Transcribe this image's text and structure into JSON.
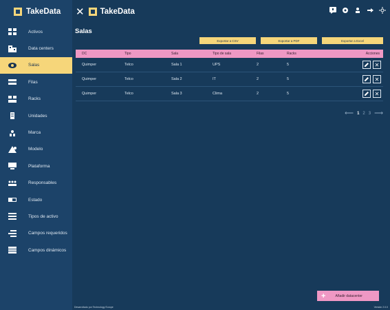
{
  "brand": {
    "name": "TakeData",
    "accent": "#f6d67a",
    "pink": "#ef98c4"
  },
  "sidebar": {
    "items": [
      {
        "label": "Activos",
        "icon": "grid-icon"
      },
      {
        "label": "Data centers",
        "icon": "building-icon"
      },
      {
        "label": "Salas",
        "icon": "room-icon",
        "active": true
      },
      {
        "label": "Filas",
        "icon": "rows-icon"
      },
      {
        "label": "Racks",
        "icon": "rack-icon"
      },
      {
        "label": "Unidades",
        "icon": "unit-icon"
      },
      {
        "label": "Marca",
        "icon": "brand-icon"
      },
      {
        "label": "Modelo",
        "icon": "model-icon"
      },
      {
        "label": "Plataforma",
        "icon": "platform-icon"
      },
      {
        "label": "Responsables",
        "icon": "people-icon"
      },
      {
        "label": "Estado",
        "icon": "status-icon"
      },
      {
        "label": "Tipos de activo",
        "icon": "list-icon"
      },
      {
        "label": "Campos requeridos",
        "icon": "required-fields-icon"
      },
      {
        "label": "Campos dinámicos",
        "icon": "dynamic-fields-icon"
      }
    ]
  },
  "header": {
    "title": "TakeData"
  },
  "main": {
    "title": "Salas",
    "exports": {
      "csv": "Exportar a CSV",
      "pdf": "Exportar a PDF",
      "excel": "Exportar a Excel"
    },
    "table": {
      "headers": {
        "dc": "DC",
        "tipo": "Tipo",
        "sala": "Sala",
        "tipo_sala": "Tipo de sala",
        "filas": "Filas",
        "racks": "Racks",
        "acciones": "Acciones"
      },
      "rows": [
        {
          "dc": "Quimper",
          "tipo": "Telco",
          "sala": "Sala 1",
          "tipo_sala": "UPS",
          "filas": "2",
          "racks": "5"
        },
        {
          "dc": "Quimper",
          "tipo": "Telco",
          "sala": "Sala 2",
          "tipo_sala": "IT",
          "filas": "2",
          "racks": "5"
        },
        {
          "dc": "Quimper",
          "tipo": "Telco",
          "sala": "Sala 3",
          "tipo_sala": "Clima",
          "filas": "2",
          "racks": "5"
        }
      ]
    },
    "pagination": {
      "pages": [
        "1",
        "2",
        "3"
      ],
      "current": "1"
    },
    "add_button": "Añadir datacenter"
  },
  "footer": {
    "left": "Desarrollado por Technology Europe",
    "right": "Versión 2.0.0"
  }
}
